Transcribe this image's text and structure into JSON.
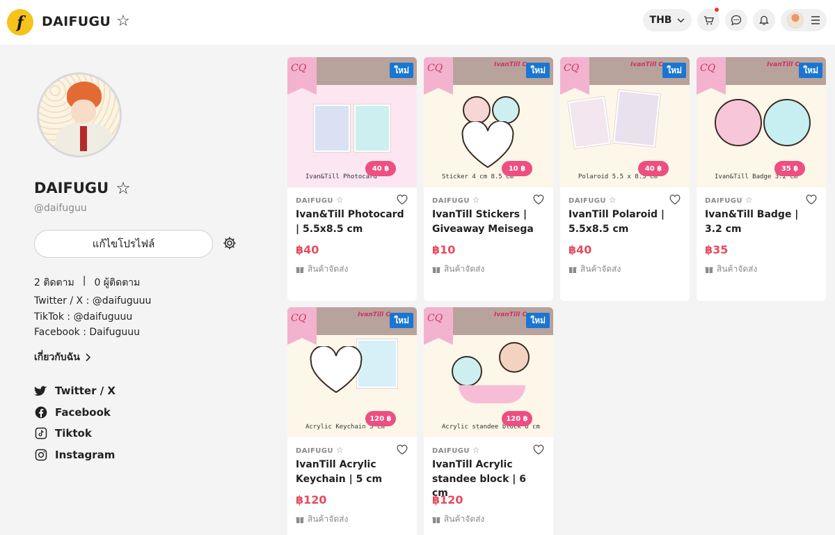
{
  "header": {
    "logo_letter": "f",
    "brand": "DAIFUGU",
    "currency": "THB"
  },
  "profile": {
    "name": "DAIFUGU",
    "handle": "@daifuguu",
    "edit_button": "แก้ไขโปรไฟล์",
    "following": "2 ติดตาม",
    "separator": "|",
    "followers": "0 ผู้ติดตาม",
    "bio": [
      "Twitter / X : @daifuguuu",
      "TikTok : @daifuguuu",
      "Facebook : Daifuguuu"
    ],
    "about_label": "เกี่ยวกับฉัน",
    "socials": [
      {
        "label": "Twitter / X",
        "icon": "twitter-icon"
      },
      {
        "label": "Facebook",
        "icon": "facebook-icon"
      },
      {
        "label": "Tiktok",
        "icon": "tiktok-icon"
      },
      {
        "label": "Instagram",
        "icon": "instagram-icon"
      }
    ]
  },
  "products": [
    {
      "shop": "DAIFUGU",
      "title": "Ivan&Till Photocard | 5.5x8.5 cm",
      "price": "฿40",
      "shipping": "สินค้าจัดส่ง",
      "badge": "ใหม่",
      "thumb_text": "Ivan&Till Photocard",
      "thumb_price": "40 ฿"
    },
    {
      "shop": "DAIFUGU",
      "title": "IvanTill Stickers | Giveaway Meisega",
      "price": "฿10",
      "shipping": "สินค้าจัดส่ง",
      "badge": "ใหม่",
      "thumb_text": "Sticker 4 cm 8.5 cm",
      "thumb_price": "10 ฿"
    },
    {
      "shop": "DAIFUGU",
      "title": "IvanTill Polaroid | 5.5x8.5 cm",
      "price": "฿40",
      "shipping": "สินค้าจัดส่ง",
      "badge": "ใหม่",
      "thumb_text": "Polaroid 5.5 x 8.5 cm",
      "thumb_price": "40 ฿"
    },
    {
      "shop": "DAIFUGU",
      "title": "Ivan&Till Badge | 3.2 cm",
      "price": "฿35",
      "shipping": "สินค้าจัดส่ง",
      "badge": "ใหม่",
      "thumb_text": "Ivan&Till Badge 3.2 cm",
      "thumb_price": "35 ฿"
    },
    {
      "shop": "DAIFUGU",
      "title": "IvanTill Acrylic Keychain | 5 cm",
      "price": "฿120",
      "shipping": "สินค้าจัดส่ง",
      "badge": "ใหม่",
      "thumb_text": "Acrylic Keychain 5 cm",
      "thumb_price": "120 ฿"
    },
    {
      "shop": "DAIFUGU",
      "title": "IvanTill Acrylic standee block | 6 cm",
      "price": "฿120",
      "shipping": "สินค้าจัดส่ง",
      "badge": "ใหม่",
      "thumb_text": "Acrylic standee block 6 cm",
      "thumb_price": "120 ฿"
    }
  ],
  "thumb_common": {
    "ribbon": "CQ",
    "deco": "IvanTill Ca"
  },
  "colors": {
    "accent_price": "#e84a5f",
    "badge_blue": "#1976d2",
    "logo_yellow": "#f6c21c",
    "tag_pink": "#ec4f80"
  }
}
